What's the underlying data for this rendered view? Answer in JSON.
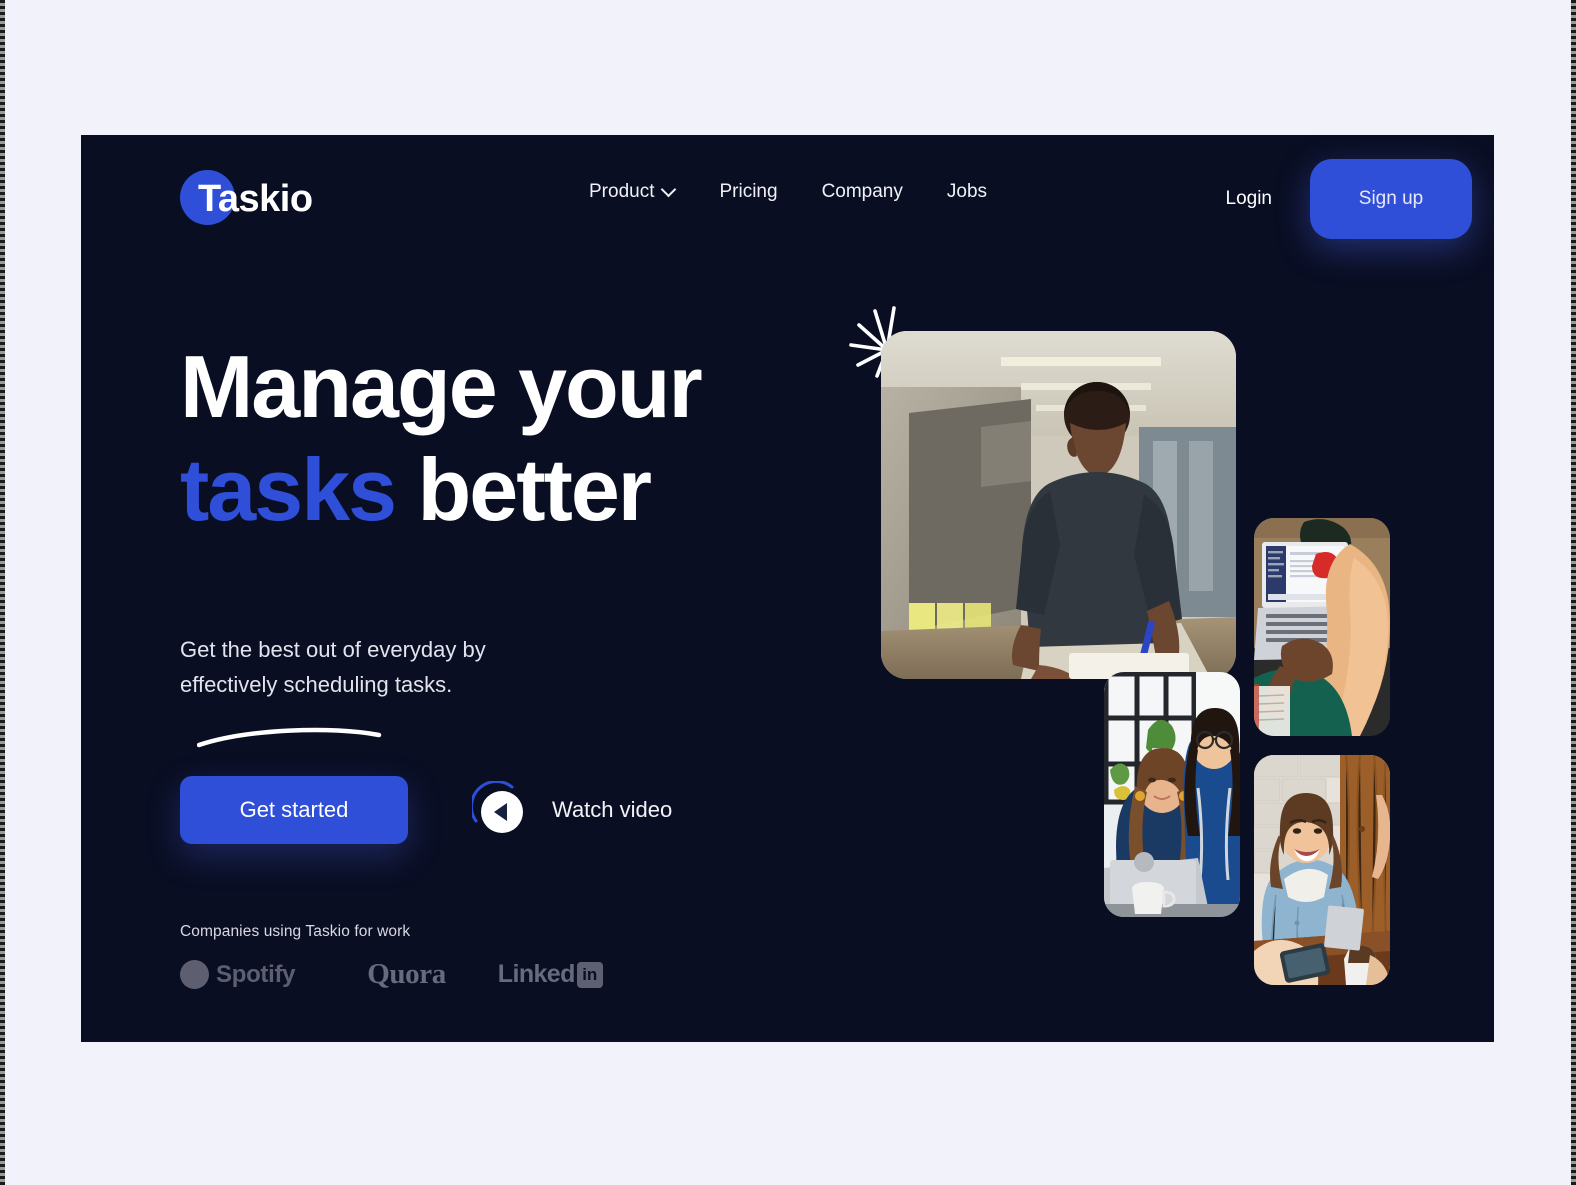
{
  "theme": {
    "page_background": "#f2f2fb",
    "card_background": "#0a0e23",
    "accent_blue": "#2f4fd8",
    "text_light": "#ffffff",
    "muted_logo": "#cfd0de"
  },
  "navbar": {
    "brand": "Taskio",
    "brand_circle_icon": "circle-shape",
    "links": [
      {
        "label": "Product",
        "has_chevron": true,
        "chevron_icon": "chevron-down-icon"
      },
      {
        "label": "Pricing",
        "has_chevron": false
      },
      {
        "label": "Company",
        "has_chevron": false
      },
      {
        "label": "Jobs",
        "has_chevron": false
      }
    ],
    "login_label": "Login",
    "signup_label": "Sign up"
  },
  "hero": {
    "headline_line1": "Manage your",
    "headline_accent": "tasks",
    "headline_rest": " better",
    "underline_icon": "curved-underline-swoosh",
    "subtext_line1": "Get the best out of everyday by",
    "subtext_line2": "effectively scheduling tasks.",
    "primary_cta": "Get started",
    "video_cta": "Watch video",
    "play_icon": "play-triangle-icon",
    "starburst_icon": "starburst-sparkle-icon"
  },
  "companies": {
    "label": "Companies using Taskio for work",
    "logos": [
      {
        "name": "Spotify",
        "icon": "spotify-logo"
      },
      {
        "name": "Quora",
        "icon": "quora-logo"
      },
      {
        "name": "Linked",
        "badge": "in",
        "icon": "linkedin-logo"
      }
    ]
  },
  "collage": {
    "photos": [
      {
        "id": "photo-main",
        "alt": "Man in dark t-shirt writing with a pen at a standing desk in an office"
      },
      {
        "id": "photo-laptop",
        "alt": "Overhead view of a person in a tan hat typing on a laptop"
      },
      {
        "id": "photo-women",
        "alt": "Two women looking at a laptop screen together by a window"
      },
      {
        "id": "photo-denim",
        "alt": "Smiling woman in a denim shirt at a wooden table with a tablet"
      }
    ]
  }
}
